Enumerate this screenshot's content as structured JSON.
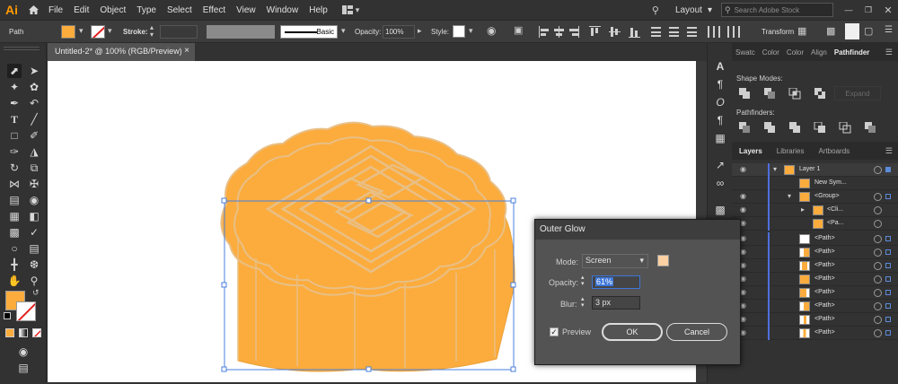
{
  "app": {
    "logo": "Ai"
  },
  "menu": [
    "File",
    "Edit",
    "Object",
    "Type",
    "Select",
    "Effect",
    "View",
    "Window",
    "Help"
  ],
  "topright": {
    "workspace": "Layout",
    "search_placeholder": "Search Adobe Stock"
  },
  "control": {
    "selection_label": "Path",
    "stroke_label": "Stroke:",
    "brush_label": "Basic",
    "opacity_label": "Opacity:",
    "opacity_value": "100%",
    "style_label": "Style:",
    "transform_label": "Transform",
    "fill_color": "#fbac3d"
  },
  "document": {
    "tab_title": "Untitled-2* @ 100% (RGB/Preview)",
    "tab_close": "×"
  },
  "panels": {
    "top_tabs": [
      "Swatc",
      "Color",
      "Color",
      "Align",
      "Pathfinder"
    ],
    "shape_modes_label": "Shape Modes:",
    "expand_label": "Expand",
    "pathfinders_label": "Pathfinders:",
    "layers_tabs": [
      "Layers",
      "Libraries",
      "Artboards"
    ]
  },
  "layers": [
    {
      "name": "Layer 1"
    },
    {
      "name": "New Sym..."
    },
    {
      "name": "<Group>"
    },
    {
      "name": "<Cli..."
    },
    {
      "name": "<Pa..."
    },
    {
      "name": "<Path>"
    },
    {
      "name": "<Path>"
    },
    {
      "name": "<Path>"
    },
    {
      "name": "<Path>"
    },
    {
      "name": "<Path>"
    },
    {
      "name": "<Path>"
    },
    {
      "name": "<Path>"
    },
    {
      "name": "<Path>"
    }
  ],
  "dialog": {
    "title": "Outer Glow",
    "mode_label": "Mode:",
    "mode_value": "Screen",
    "opacity_label": "Opacity:",
    "opacity_value": "61%",
    "blur_label": "Blur:",
    "blur_value": "3 px",
    "preview_label": "Preview",
    "ok_label": "OK",
    "cancel_label": "Cancel",
    "glow_color": "#fbd0a2"
  },
  "colors": {
    "cake_fill": "#fbac3d",
    "pattern": "#e9bf85",
    "selection": "#4a7fdc"
  }
}
